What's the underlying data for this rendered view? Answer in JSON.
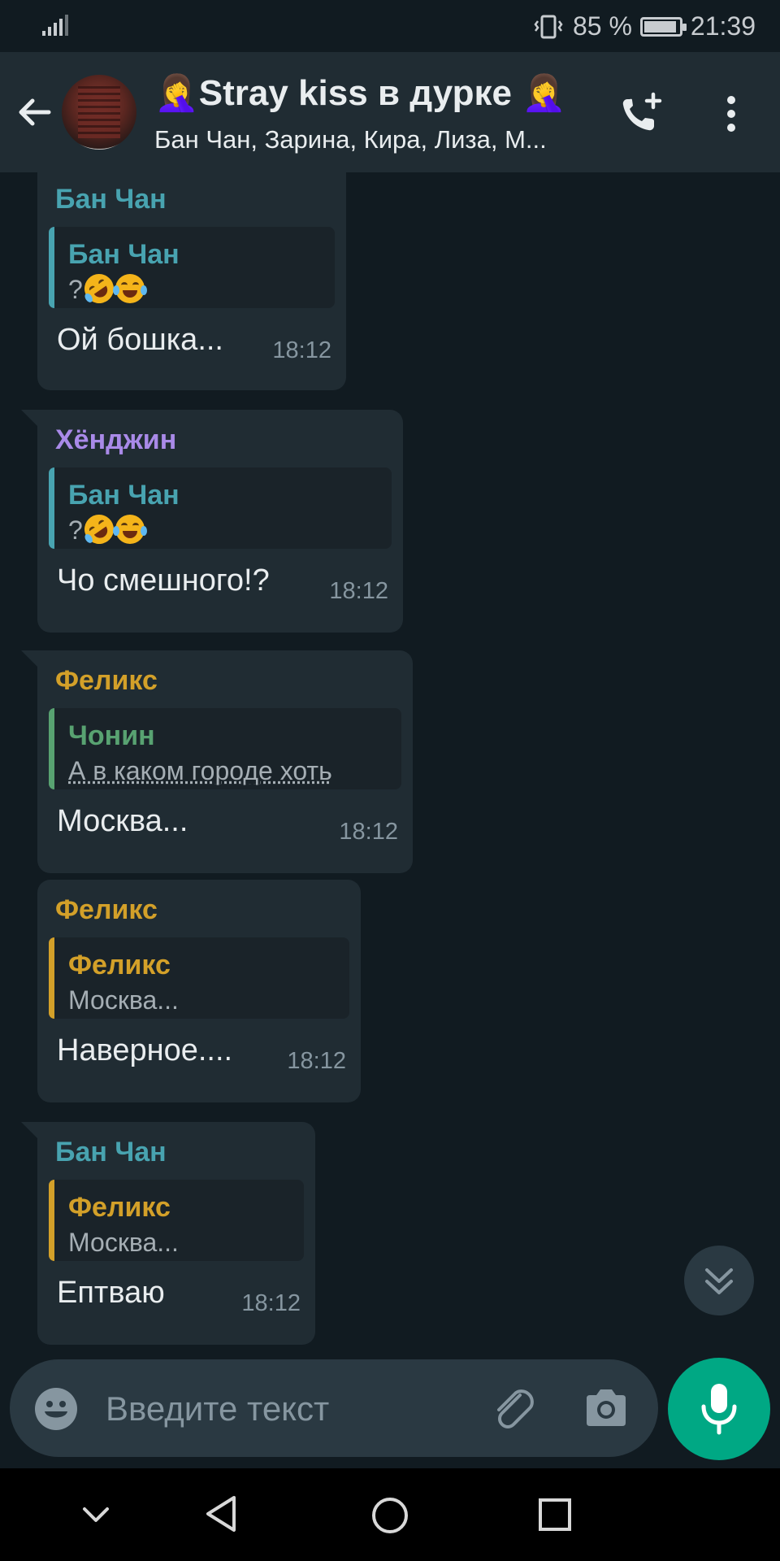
{
  "status_bar": {
    "battery_percent": "85 %",
    "battery_level": 0.85,
    "time": "21:39"
  },
  "header": {
    "title": "🤦‍♀️Stray kiss в дурке 🤦‍♀️",
    "title_text": "Stray kiss в дурке",
    "subtitle": "Бан Чан, Зарина, Кира, Лиза, М...",
    "icons": [
      "back-arrow-icon",
      "add-call-icon",
      "more-vert-icon"
    ]
  },
  "messages": [
    {
      "sender": "Бан Чан",
      "sender_color": "#48a3b0",
      "quote": {
        "name": "Бан Чан",
        "name_color": "#48a3b0",
        "text": "?"
      },
      "text": "Ой бошка...",
      "time": "18:12"
    },
    {
      "sender": "Хёнджин",
      "sender_color": "#a98ae8",
      "quote": {
        "name": "Бан Чан",
        "name_color": "#48a3b0",
        "text": "?"
      },
      "text": "Чо смешного!?",
      "time": "18:12"
    },
    {
      "sender": "Феликс",
      "sender_color": "#d3a029",
      "quote": {
        "name": "Чонин",
        "name_color": "#58a271",
        "text": "А в каком городе хоть"
      },
      "text": "Москва...",
      "time": "18:12"
    },
    {
      "sender": "Феликс",
      "sender_color": "#d3a029",
      "quote": {
        "name": "Феликс",
        "name_color": "#d3a029",
        "text": "Москва..."
      },
      "text": "Наверное....",
      "time": "18:12"
    },
    {
      "sender": "Бан Чан",
      "sender_color": "#48a3b0",
      "quote": {
        "name": "Феликс",
        "name_color": "#d3a029",
        "text": "Москва..."
      },
      "text": "Ептваю",
      "time": "18:12"
    }
  ],
  "input": {
    "placeholder": "Введите текст",
    "value": ""
  },
  "colors": {
    "background": "#111b21",
    "bubble": "#202c33",
    "accent": "#00a884",
    "meta": "#8696a0"
  }
}
